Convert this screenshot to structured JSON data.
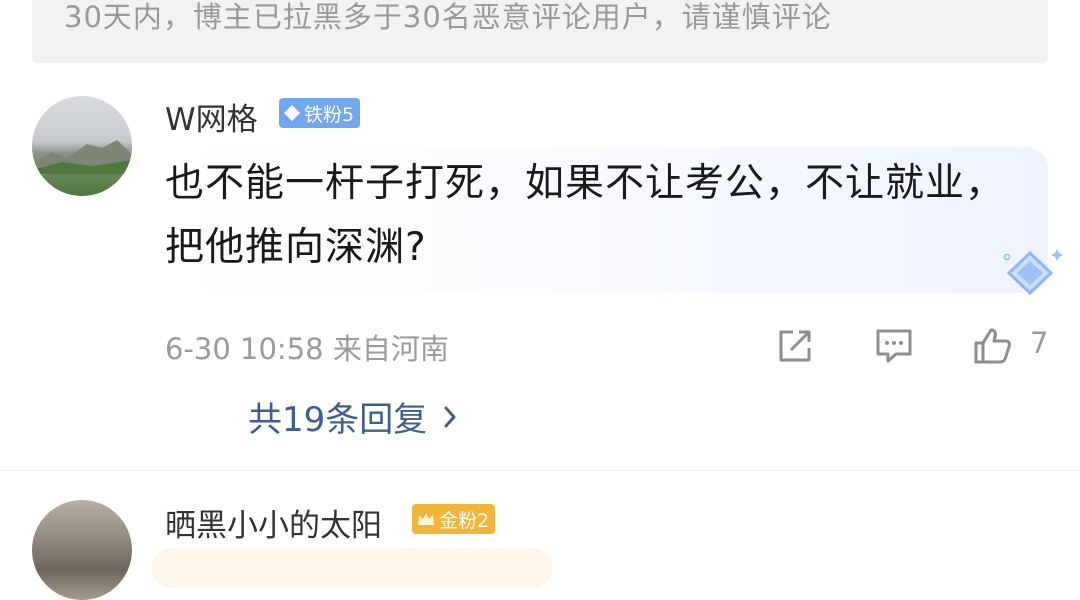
{
  "notice": {
    "text": "30天内，博主已拉黑多于30名恶意评论用户，请谨慎评论"
  },
  "comments": [
    {
      "username": "W网格",
      "badge": "铁粉5",
      "badge_color": "#6fa8f0",
      "text": "也不能一杆子打死，如果不让考公，不让就业，把他推向深渊?",
      "time": "6-30 10:58",
      "location": "来自河南",
      "like_count": "7",
      "replies_label": "共19条回复"
    },
    {
      "username": "晒黑小小的太阳",
      "badge": "金粉2",
      "badge_color": "#f2b53a"
    }
  ],
  "icons": [
    "share-icon",
    "comment-icon",
    "like-icon",
    "chevron-right-icon",
    "diamond-icon",
    "crown-icon"
  ]
}
